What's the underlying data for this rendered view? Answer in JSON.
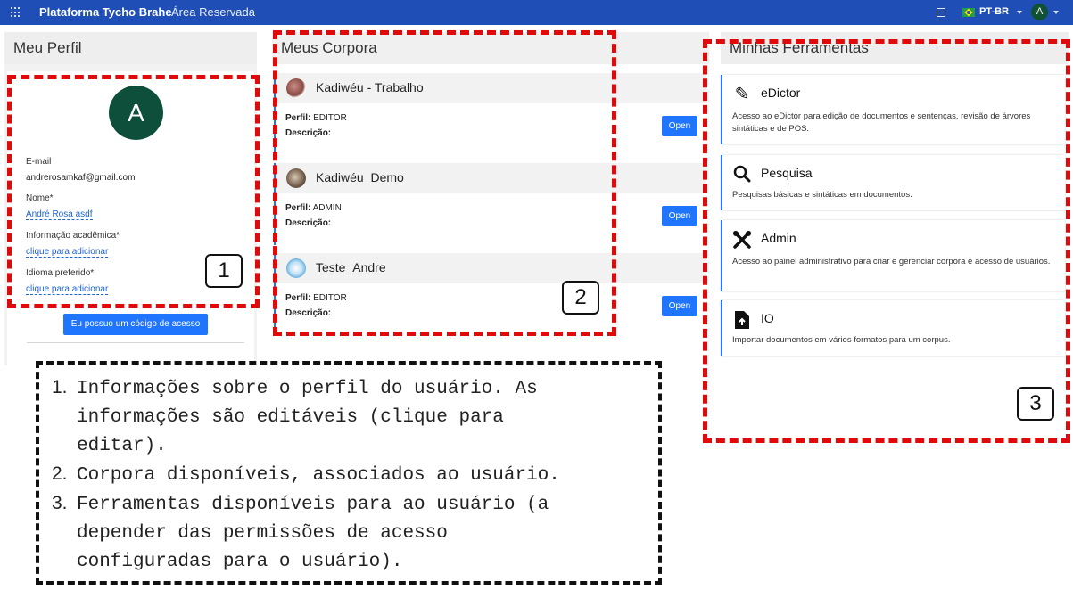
{
  "topbar": {
    "brand": "Plataforma Tycho Brahe",
    "brand_sub": "Área Reservada",
    "language": "PT-BR",
    "user_initial": "A",
    "icons": [
      "apps-grid-icon",
      "book-icon",
      "brazil-flag-icon",
      "chevron-down-icon"
    ],
    "background": "#1f4fb6"
  },
  "profile": {
    "title": "Meu Perfil",
    "avatar_initial": "A",
    "avatar_color": "#0d4f3b",
    "email_label": "E-mail",
    "email_value": "andrerosamkaf@gmail.com",
    "name_label": "Nome*",
    "name_value": "André Rosa asdf",
    "academic_label": "Informação acadêmica*",
    "academic_value": "clique para adicionar",
    "language_label": "Idioma preferido*",
    "language_value": "clique para adicionar",
    "access_button": "Eu possuo um código de acesso"
  },
  "corpora": {
    "title": "Meus Corpora",
    "items": [
      {
        "name": "Kadiwéu - Trabalho",
        "perfil_label": "Perfil:",
        "perfil_value": "EDITOR",
        "descricao_label": "Descrição:",
        "open_label": "Open"
      },
      {
        "name": "Kadiwéu_Demo",
        "perfil_label": "Perfil:",
        "perfil_value": "ADMIN",
        "descricao_label": "Descrição:",
        "open_label": "Open"
      },
      {
        "name": "Teste_Andre",
        "perfil_label": "Perfil:",
        "perfil_value": "EDITOR",
        "descricao_label": "Descrição:",
        "open_label": "Open"
      }
    ]
  },
  "tools": {
    "title": "Minhas Ferramentas",
    "items": [
      {
        "name": "eDictor",
        "icon": "pencil-icon",
        "description": "Acesso ao eDictor para edição de documentos e sentenças, revisão de árvores sintáticas e de POS."
      },
      {
        "name": "Pesquisa",
        "icon": "search-icon",
        "description": "Pesquisas básicas e sintáticas em documentos."
      },
      {
        "name": "Admin",
        "icon": "tools-icon",
        "description": "Acesso ao painel administrativo para criar e gerenciar corpora e acesso de usuários."
      },
      {
        "name": "IO",
        "icon": "file-upload-icon",
        "description": "Importar documentos em vários formatos para um corpus."
      }
    ]
  },
  "annotations": {
    "marker_1": "1",
    "marker_2": "2",
    "marker_3": "3",
    "legend": [
      {
        "num": "1.",
        "lines": [
          "Informações sobre o perfil do usuário. As",
          "informações são editáveis (clique para",
          "editar)."
        ]
      },
      {
        "num": "2.",
        "lines": [
          "Corpora disponíveis, associados ao usuário."
        ]
      },
      {
        "num": "3.",
        "lines": [
          "Ferramentas disponíveis para ao usuário (a",
          "depender das permissões de acesso",
          "configuradas para o usuário)."
        ]
      }
    ],
    "highlight_color": "#e00a0a",
    "accent_color": "#1f75fe"
  }
}
